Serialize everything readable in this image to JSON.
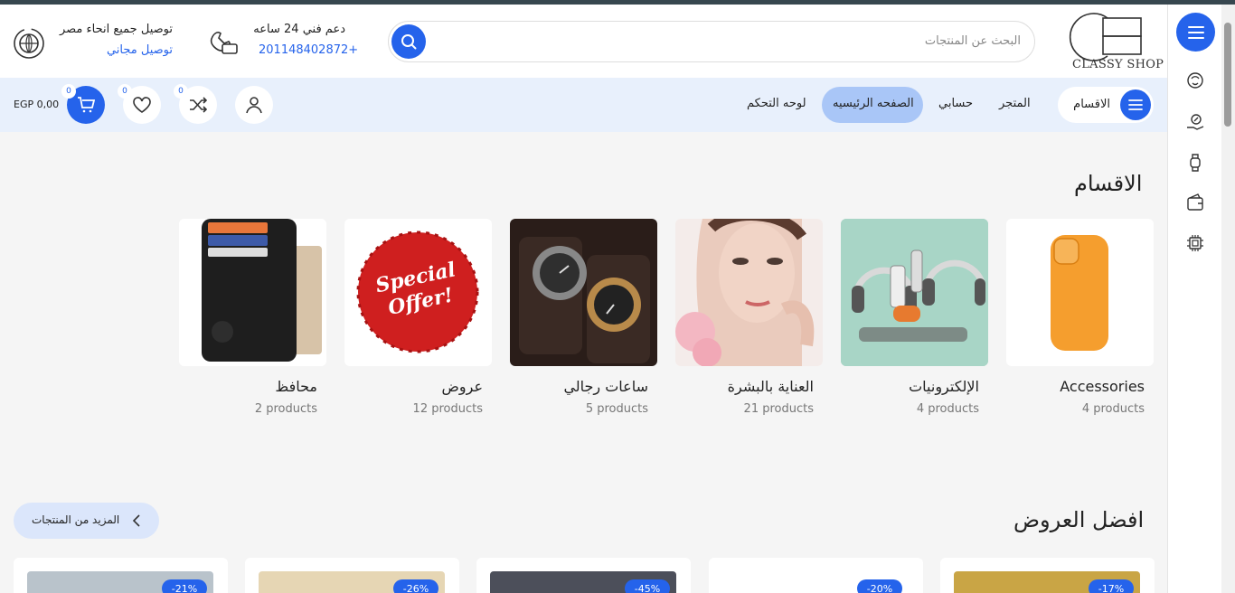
{
  "header": {
    "logo_text": "CLASSY SHOP",
    "search_placeholder": "البحث عن المنتجات",
    "support_title": "دعم فني 24 ساعه",
    "support_phone": "201148402872+",
    "shipping_title": "توصيل جميع انحاء مصر",
    "shipping_sub": "توصيل مجاني"
  },
  "nav": {
    "categories_label": "الاقسام",
    "links": [
      "المتجر",
      "حسابي",
      "الصفحه الرئيسيه",
      "لوحه التحكم"
    ],
    "active_link": "الصفحه الرئيسيه",
    "compare_count": "0",
    "wishlist_count": "0",
    "cart_count": "0",
    "cart_total": "EGP 0,00"
  },
  "categories_section": {
    "title": "الاقسام",
    "items": [
      {
        "name": "Accessories",
        "count": "4 products",
        "image": "orange phone case"
      },
      {
        "name": "الإلكترونيات",
        "count": "4 products",
        "image": "headphones and gadgets"
      },
      {
        "name": "العناية بالبشرة",
        "count": "21 products",
        "image": "woman skincare face"
      },
      {
        "name": "ساعات رجالي",
        "count": "5 products",
        "image": "men watches"
      },
      {
        "name": "عروض",
        "count": "12 products",
        "image": "special offer stamp"
      },
      {
        "name": "محافظ",
        "count": "2 products",
        "image": "leather wallet"
      }
    ],
    "offer_stamp_text": "Special Offer!"
  },
  "offers_section": {
    "title": "افضل العروض",
    "more_label": "المزيد من المنتجات",
    "cards": [
      {
        "discount": "-17%"
      },
      {
        "discount": "-20%"
      },
      {
        "discount": "-45%"
      },
      {
        "discount": "-26%"
      },
      {
        "discount": "-21%"
      }
    ]
  },
  "colors": {
    "accent": "#2563eb",
    "nav_bg": "#e8f0fc",
    "active_pill": "#a9c6f7"
  }
}
